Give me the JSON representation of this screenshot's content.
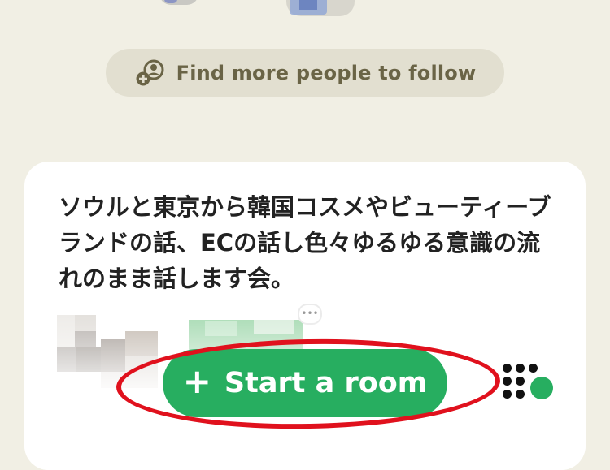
{
  "header": {
    "find_people_label": "Find more people to follow",
    "find_people_icon": "add-person-icon"
  },
  "room_card": {
    "title": "ソウルと東京から韓国コスメやビューティーブランドの話、ECの話し色々ゆるゆる意識の流れのまま話します会。",
    "speaker_overflow_icon": "more-dots-icon"
  },
  "footer": {
    "start_room_label": "Start a room",
    "start_room_icon": "plus-icon",
    "grid_icon": "dot-grid-icon",
    "watermark": "blur"
  },
  "colors": {
    "background": "#f1efe4",
    "pill": "#e2dfd0",
    "accent_green": "#27ae60",
    "annotation_red": "#e0111d"
  }
}
